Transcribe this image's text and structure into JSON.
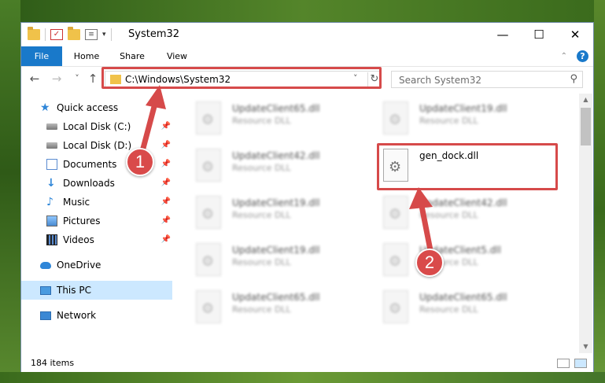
{
  "window": {
    "title": "System32",
    "minimize_glyph": "—",
    "maximize_glyph": "☐",
    "close_glyph": "✕"
  },
  "ribbon": {
    "tabs": [
      {
        "label": "File"
      },
      {
        "label": "Home"
      },
      {
        "label": "Share"
      },
      {
        "label": "View"
      }
    ]
  },
  "nav": {
    "back_glyph": "←",
    "forward_glyph": "→",
    "recent_glyph": "˅",
    "up_glyph": "↑",
    "address": "C:\\Windows\\System32",
    "search_placeholder": "Search System32"
  },
  "sidebar": {
    "items": [
      {
        "label": "Quick access",
        "icon": "star-icon"
      },
      {
        "label": "Local Disk (C:)",
        "icon": "drive-icon",
        "pinned": true
      },
      {
        "label": "Local Disk (D:)",
        "icon": "drive-icon",
        "pinned": true
      },
      {
        "label": "Documents",
        "icon": "documents-icon",
        "pinned": true
      },
      {
        "label": "Downloads",
        "icon": "downloads-icon",
        "pinned": true
      },
      {
        "label": "Music",
        "icon": "music-icon",
        "pinned": true
      },
      {
        "label": "Pictures",
        "icon": "pictures-icon",
        "pinned": true
      },
      {
        "label": "Videos",
        "icon": "videos-icon",
        "pinned": true
      },
      {
        "label": "OneDrive",
        "icon": "onedrive-icon"
      },
      {
        "label": "This PC",
        "icon": "this-pc-icon",
        "selected": true
      },
      {
        "label": "Network",
        "icon": "network-icon"
      }
    ]
  },
  "files": [
    {
      "name": "UpdateClient65.dll",
      "type": "Resource DLL"
    },
    {
      "name": "UpdateClient19.dll",
      "type": "Resource DLL"
    },
    {
      "name": "UpdateClient42.dll",
      "type": "Resource DLL"
    },
    {
      "name": "gen_dock.dll",
      "type": ""
    },
    {
      "name": "UpdateClient19.dll",
      "type": "Resource DLL"
    },
    {
      "name": "UpdateClient42.dll",
      "type": "Resource DLL"
    },
    {
      "name": "UpdateClient19.dll",
      "type": "Resource DLL"
    },
    {
      "name": "UpdateClient5.dll",
      "type": "Resource DLL"
    },
    {
      "name": "UpdateClient65.dll",
      "type": "Resource DLL"
    },
    {
      "name": "UpdateClient65.dll",
      "type": "Resource DLL"
    }
  ],
  "status": {
    "item_count": "184 items"
  },
  "annotations": {
    "step1": "1",
    "step2": "2",
    "color": "#d64a4a"
  }
}
